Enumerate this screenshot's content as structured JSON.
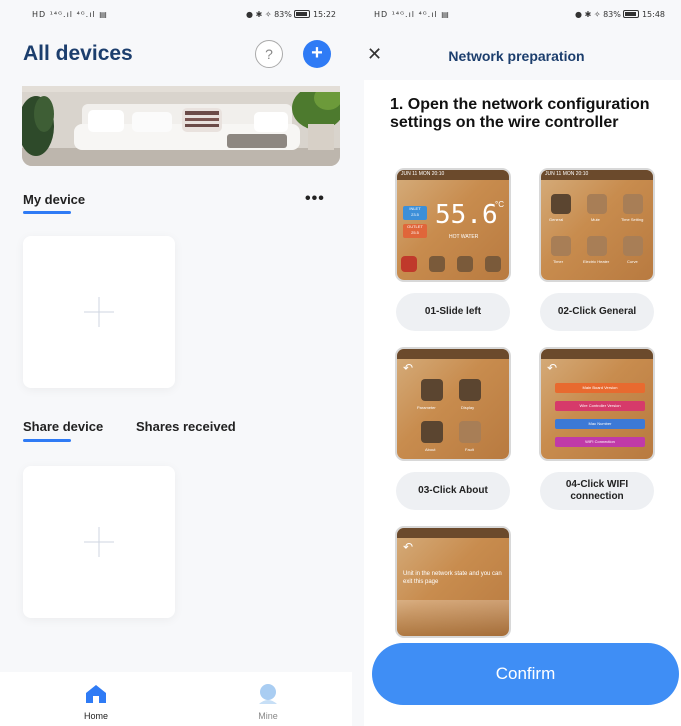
{
  "left": {
    "status_bar": {
      "signal": "HD ¹⁴ᴳ.ıl ⁴ᴳ.ıl ▤",
      "right": "● ✱ ✧ 83%",
      "time": "15:22"
    },
    "title": "All devices",
    "help_icon_glyph": "?",
    "add_icon_glyph": "+",
    "my_device_tab": "My device",
    "more_icon_glyph": "•••",
    "share_device_tab": "Share device",
    "shares_received_tab": "Shares received",
    "nav": [
      {
        "label": "Home",
        "icon": "home-icon",
        "active": true
      },
      {
        "label": "Mine",
        "icon": "user-icon",
        "active": false
      }
    ],
    "accent": "#2f7bf5",
    "title_color": "#1c3e6d"
  },
  "right": {
    "status_bar": {
      "signal": "HD ¹⁴ᴳ.ıl ⁴ᴳ.ıl ▤",
      "right": "● ✱ ✧ 83%",
      "time": "15:48"
    },
    "close_glyph": "✕",
    "title": "Network preparation",
    "step_title": "1. Open the network configuration settings on the wire controller",
    "screen1": {
      "date": "JUN 11 MON 20:10",
      "inlet_label": "INLET",
      "inlet_value": "23.5",
      "outlet_label": "OUTLET",
      "outlet_value": "25.5",
      "big_temp": "55.6",
      "unit": "°C",
      "hot_water": "HOT WATER"
    },
    "screen2": {
      "date": "JUN 11 MON 20:10",
      "icons": [
        "General",
        "Mute",
        "Time Setting",
        "Timer",
        "Electric Heater",
        "Curve"
      ]
    },
    "screen3": {
      "items": [
        "Parameter",
        "Display",
        "About",
        "Fault"
      ]
    },
    "screen4": {
      "items": [
        "Main Board Version",
        "Wire Controller Version",
        "Mac Number",
        "WIFI Connection"
      ]
    },
    "screen5": {
      "text": "Unit in the network state and you can exit this page"
    },
    "steps": [
      {
        "label": "01-Slide left"
      },
      {
        "label": "02-Click General"
      },
      {
        "label": "03-Click About"
      },
      {
        "label": "04-Click WIFI connection"
      }
    ],
    "confirm_label": "Confirm",
    "confirm_color": "#3f8ef5"
  }
}
